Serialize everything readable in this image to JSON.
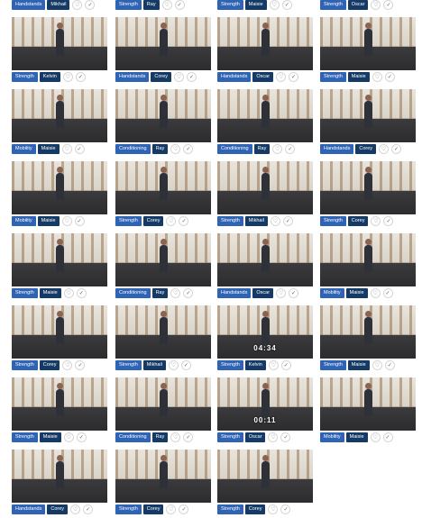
{
  "icons": {
    "favorite": "heart-icon",
    "done": "check-circle-icon"
  },
  "colors": {
    "category_tag": "#2f63b3",
    "coach_tag": "#163a66"
  },
  "videos": [
    {
      "category": "Handstands",
      "coach": "Mikhail",
      "thumb": false,
      "timer": ""
    },
    {
      "category": "Strength",
      "coach": "Ray",
      "thumb": false,
      "timer": ""
    },
    {
      "category": "Strength",
      "coach": "Maisie",
      "thumb": false,
      "timer": ""
    },
    {
      "category": "Strength",
      "coach": "Oscar",
      "thumb": false,
      "timer": ""
    },
    {
      "category": "Strength",
      "coach": "Kelvin",
      "thumb": true,
      "timer": ""
    },
    {
      "category": "Handstands",
      "coach": "Corey",
      "thumb": true,
      "timer": ""
    },
    {
      "category": "Handstands",
      "coach": "Oscar",
      "thumb": true,
      "timer": ""
    },
    {
      "category": "Strength",
      "coach": "Maisie",
      "thumb": true,
      "timer": ""
    },
    {
      "category": "Mobility",
      "coach": "Maisie",
      "thumb": true,
      "timer": ""
    },
    {
      "category": "Conditioning",
      "coach": "Ray",
      "thumb": true,
      "timer": ""
    },
    {
      "category": "Conditioning",
      "coach": "Ray",
      "thumb": true,
      "timer": ""
    },
    {
      "category": "Handstands",
      "coach": "Corey",
      "thumb": true,
      "timer": ""
    },
    {
      "category": "Mobility",
      "coach": "Maisie",
      "thumb": true,
      "timer": ""
    },
    {
      "category": "Strength",
      "coach": "Corey",
      "thumb": true,
      "timer": ""
    },
    {
      "category": "Strength",
      "coach": "Mikhail",
      "thumb": true,
      "timer": ""
    },
    {
      "category": "Strength",
      "coach": "Corey",
      "thumb": true,
      "timer": ""
    },
    {
      "category": "Strength",
      "coach": "Maisie",
      "thumb": true,
      "timer": ""
    },
    {
      "category": "Conditioning",
      "coach": "Ray",
      "thumb": true,
      "timer": ""
    },
    {
      "category": "Handstands",
      "coach": "Oscar",
      "thumb": true,
      "timer": ""
    },
    {
      "category": "Mobility",
      "coach": "Maisie",
      "thumb": true,
      "timer": ""
    },
    {
      "category": "Strength",
      "coach": "Corey",
      "thumb": true,
      "timer": ""
    },
    {
      "category": "Strength",
      "coach": "Mikhail",
      "thumb": true,
      "timer": ""
    },
    {
      "category": "Strength",
      "coach": "Kelvin",
      "thumb": true,
      "timer": "04:34"
    },
    {
      "category": "Strength",
      "coach": "Maisie",
      "thumb": true,
      "timer": ""
    },
    {
      "category": "Strength",
      "coach": "Maisie",
      "thumb": true,
      "timer": ""
    },
    {
      "category": "Conditioning",
      "coach": "Ray",
      "thumb": true,
      "timer": ""
    },
    {
      "category": "Strength",
      "coach": "Oscar",
      "thumb": true,
      "timer": "00:11"
    },
    {
      "category": "Mobility",
      "coach": "Maisie",
      "thumb": true,
      "timer": ""
    },
    {
      "category": "Handstands",
      "coach": "Corey",
      "thumb": true,
      "timer": ""
    },
    {
      "category": "Strength",
      "coach": "Corey",
      "thumb": true,
      "timer": ""
    },
    {
      "category": "Strength",
      "coach": "Corey",
      "thumb": true,
      "timer": ""
    }
  ]
}
